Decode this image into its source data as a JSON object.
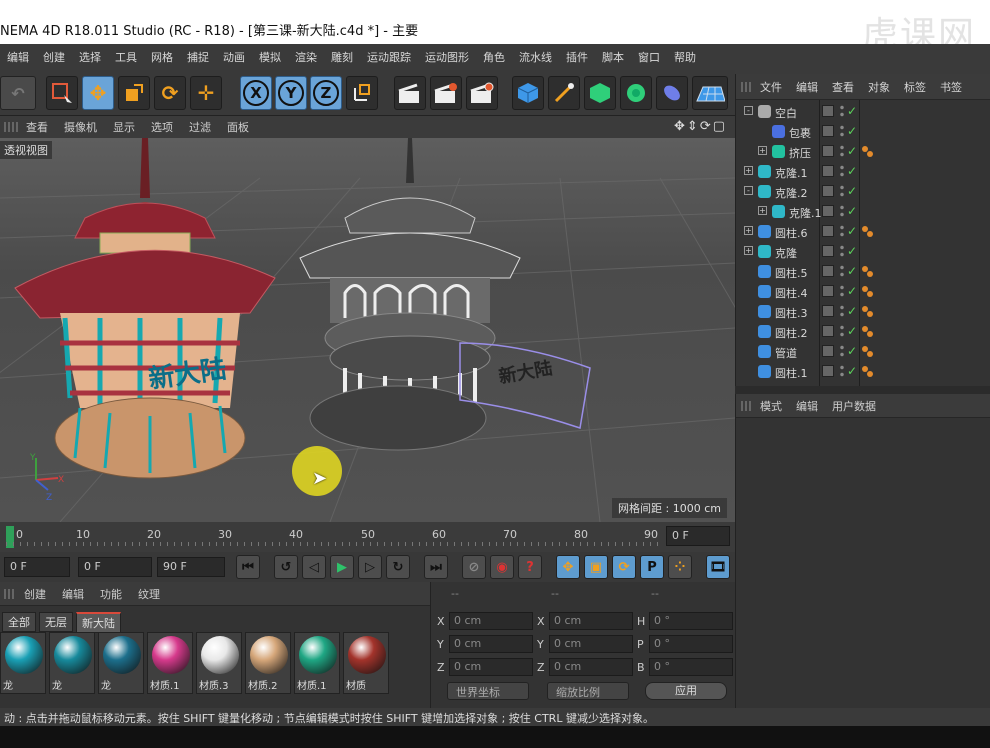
{
  "window": {
    "title": "NEMA 4D R18.011 Studio (RC - R18) - [第三课-新大陆.c4d *] - 主要",
    "watermark": "虎课网"
  },
  "menubar": [
    "编辑",
    "创建",
    "选择",
    "工具",
    "网格",
    "捕捉",
    "动画",
    "模拟",
    "渲染",
    "雕刻",
    "运动跟踪",
    "运动图形",
    "角色",
    "流水线",
    "插件",
    "脚本",
    "窗口",
    "帮助"
  ],
  "viewport": {
    "menu": [
      "查看",
      "摄像机",
      "显示",
      "选项",
      "过滤",
      "面板"
    ],
    "label": "透视视图",
    "grid_spacing": "网格间距 : 1000 cm",
    "nav_icons": "✥⇕⟳▢"
  },
  "timeline": {
    "ticks": [
      "0",
      "10",
      "20",
      "30",
      "40",
      "50",
      "60",
      "70",
      "80",
      "90"
    ],
    "current_frame": "0 F"
  },
  "transport": {
    "start": "0 F",
    "min": "0 F",
    "max": "90 F",
    "end": "90 F"
  },
  "materials": {
    "menu": [
      "创建",
      "编辑",
      "功能",
      "纹理"
    ],
    "tabs": [
      "全部",
      "无层",
      "新大陆"
    ],
    "active_tab": "新大陆",
    "items": [
      {
        "name": "龙",
        "color": "#1aa0b5"
      },
      {
        "name": "龙",
        "color": "#178a9c"
      },
      {
        "name": "龙",
        "color": "#1c6f8c"
      },
      {
        "name": "材质.1",
        "color": "#d63a8c"
      },
      {
        "name": "材质.3",
        "color": "#e8e8e8"
      },
      {
        "name": "材质.2",
        "color": "#d6a77a"
      },
      {
        "name": "材质.1",
        "color": "#1fa784"
      },
      {
        "name": "材质",
        "color": "#a3332b"
      }
    ]
  },
  "coordinates": {
    "headers": [
      "--",
      "--",
      "--"
    ],
    "rows": [
      {
        "a": "X",
        "av": "0 cm",
        "b": "X",
        "bv": "0 cm",
        "c": "H",
        "cv": "0 °"
      },
      {
        "a": "Y",
        "av": "0 cm",
        "b": "Y",
        "bv": "0 cm",
        "c": "P",
        "cv": "0 °"
      },
      {
        "a": "Z",
        "av": "0 cm",
        "b": "Z",
        "bv": "0 cm",
        "c": "B",
        "cv": "0 °"
      }
    ],
    "world": "世界坐标",
    "scale": "缩放比例",
    "apply": "应用"
  },
  "objects": {
    "menu": [
      "文件",
      "编辑",
      "查看",
      "对象",
      "标签",
      "书签"
    ],
    "items": [
      {
        "name": "空白",
        "indent": 0,
        "expand": "-",
        "icon": "#aaaaaa",
        "tag": false
      },
      {
        "name": "包裹",
        "indent": 1,
        "expand": "",
        "icon": "#4a6fe0",
        "tag": false
      },
      {
        "name": "挤压",
        "indent": 1,
        "expand": "+",
        "icon": "#22c2a0",
        "tag": true
      },
      {
        "name": "克隆.1",
        "indent": 0,
        "expand": "+",
        "icon": "#2fb8c8",
        "tag": false
      },
      {
        "name": "克隆.2",
        "indent": 0,
        "expand": "-",
        "icon": "#2fb8c8",
        "tag": false
      },
      {
        "name": "克隆.1",
        "indent": 1,
        "expand": "+",
        "icon": "#2fb8c8",
        "tag": false
      },
      {
        "name": "圆柱.6",
        "indent": 0,
        "expand": "+",
        "icon": "#3f8fe0",
        "tag": true
      },
      {
        "name": "克隆",
        "indent": 0,
        "expand": "+",
        "icon": "#2fb8c8",
        "tag": false
      },
      {
        "name": "圆柱.5",
        "indent": 0,
        "expand": "",
        "icon": "#3f8fe0",
        "tag": true
      },
      {
        "name": "圆柱.4",
        "indent": 0,
        "expand": "",
        "icon": "#3f8fe0",
        "tag": true
      },
      {
        "name": "圆柱.3",
        "indent": 0,
        "expand": "",
        "icon": "#3f8fe0",
        "tag": true
      },
      {
        "name": "圆柱.2",
        "indent": 0,
        "expand": "",
        "icon": "#3f8fe0",
        "tag": true
      },
      {
        "name": "管道",
        "indent": 0,
        "expand": "",
        "icon": "#3f8fe0",
        "tag": true
      },
      {
        "name": "圆柱.1",
        "indent": 0,
        "expand": "",
        "icon": "#3f8fe0",
        "tag": true
      }
    ]
  },
  "attributes": {
    "menu": [
      "模式",
      "编辑",
      "用户数据"
    ]
  },
  "status": "动 : 点击并拖动鼠标移动元素。按住 SHIFT 键量化移动 ; 节点编辑模式时按住 SHIFT 键增加选择对象 ; 按住 CTRL 键减少选择对象。"
}
